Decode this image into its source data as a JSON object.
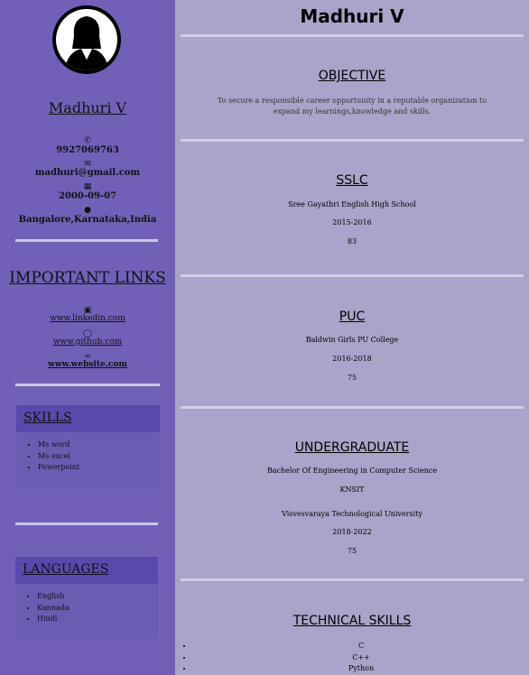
{
  "sidebar": {
    "avatar_icon": "female-user-icon",
    "name": "Madhuri V",
    "contact": {
      "phone": "9927069763",
      "email": "madhuri@gmail.com",
      "dob": "2000-09-07",
      "location": "Bangalore,Karnataka,India"
    },
    "links_title": "IMPORTANT LINKS",
    "links": [
      "www.linkedin.com",
      "www.github.com",
      "www.website.com"
    ],
    "skills_title": "SKILLS",
    "skills": [
      "Ms word",
      "Ms excel",
      "Powerpoint"
    ],
    "languages_title": "LANGUAGES",
    "languages": [
      "English",
      "Kannada",
      "Hindi"
    ]
  },
  "main": {
    "name": "Madhuri V",
    "objective_title": "OBJECTIVE",
    "objective_text": "To secure a responsible career opportunity in a reputable organization to expand my learnings,knowledge and skills.",
    "sslc_title": "SSLC",
    "sslc_school": "Sree Gayathri English High School",
    "sslc_years": "2015-2016",
    "sslc_score": "83",
    "puc_title": "PUC",
    "puc_school": "Baldwin Girls PU College",
    "puc_years": "2016-2018",
    "puc_score": "75",
    "ug_title": "UNDERGRADUATE",
    "ug_degree": "Bachelor Of Engineering in Computer Science",
    "ug_college": "KNSIT",
    "ug_university": "Visvesvaraya Technological University",
    "ug_years": "2018-2022",
    "ug_score": "75",
    "tech_title": "TECHNICAL SKILLS",
    "tech_skills": [
      "C",
      "C++",
      "Python"
    ]
  },
  "colors": {
    "sidebar": "#7260b8",
    "main": "#a9a4c9",
    "box_head": "#5a48ad"
  }
}
